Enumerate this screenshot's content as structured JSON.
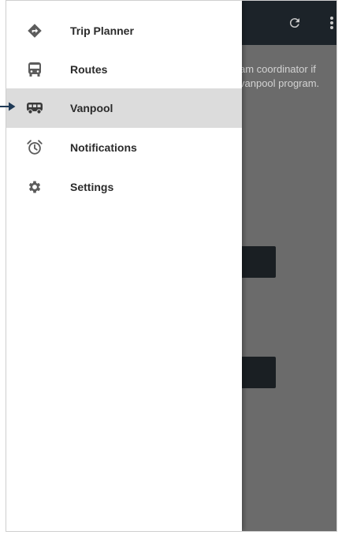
{
  "app": {
    "background_text_line1": "am coordinator if",
    "background_text_line2": "vanpool program."
  },
  "drawer": {
    "items": [
      {
        "label": "Trip Planner",
        "icon": "directions-icon",
        "active": false
      },
      {
        "label": "Routes",
        "icon": "bus-icon",
        "active": false
      },
      {
        "label": "Vanpool",
        "icon": "van-icon",
        "active": true
      },
      {
        "label": "Notifications",
        "icon": "alarm-clock-icon",
        "active": false
      },
      {
        "label": "Settings",
        "icon": "gear-icon",
        "active": false
      }
    ]
  },
  "colors": {
    "toolbar": "#1c2329",
    "scrim": "#6b6b6b",
    "active_item": "#dcdcdc",
    "icon": "#5c5c5c",
    "callout_arrow": "#1f3a56"
  }
}
